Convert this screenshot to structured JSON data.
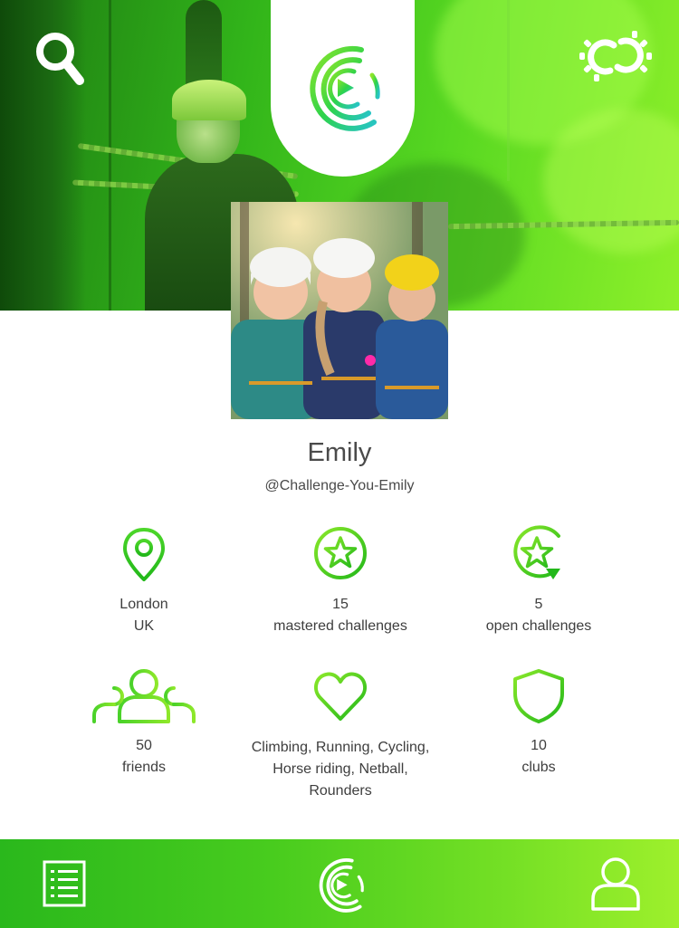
{
  "header": {
    "search_icon": "search-icon",
    "link_icon": "link-icon",
    "logo_icon": "challenge-you-logo-icon"
  },
  "profile": {
    "name": "Emily",
    "handle": "@Challenge-You-Emily"
  },
  "stats": [
    {
      "icon": "location-pin-icon",
      "line1": "London",
      "line2": "UK"
    },
    {
      "icon": "star-badge-icon",
      "line1": "15",
      "line2": "mastered challenges"
    },
    {
      "icon": "star-refresh-icon",
      "line1": "5",
      "line2": "open challenges"
    },
    {
      "icon": "friends-group-icon",
      "line1": "50",
      "line2": "friends"
    },
    {
      "icon": "heart-icon",
      "line1": "Climbing, Running, Cycling,",
      "line2": "Horse riding, Netball,",
      "line3": "Rounders"
    },
    {
      "icon": "shield-icon",
      "line1": "10",
      "line2": "clubs"
    }
  ],
  "bottom_nav": {
    "list_icon": "list-icon",
    "home_icon": "challenge-you-logo-icon",
    "profile_icon": "user-icon"
  },
  "colors": {
    "accent_dark": "#22b01a",
    "accent_light": "#9ef02c"
  }
}
